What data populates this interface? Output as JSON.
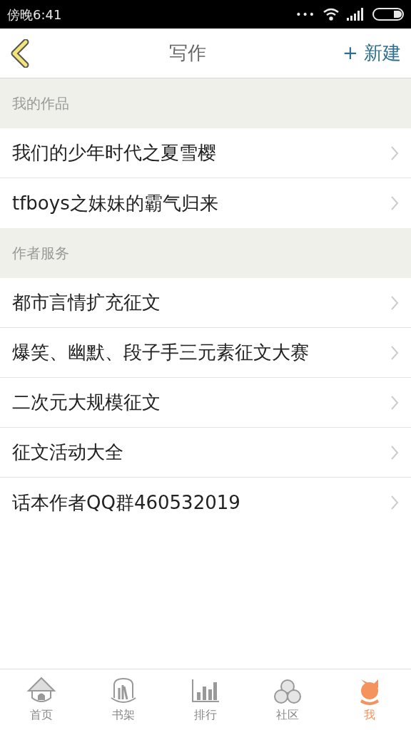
{
  "status_bar": {
    "time": "傍晚6:41",
    "dots": "•••"
  },
  "header": {
    "title": "写作",
    "action": "+ 新建"
  },
  "sections": [
    {
      "title": "我的作品",
      "items": [
        "我们的少年时代之夏雪樱",
        "tfboys之妹妹的霸气归来"
      ]
    },
    {
      "title": "作者服务",
      "items": [
        "都市言情扩充征文",
        "爆笑、幽默、段子手三元素征文大赛",
        "二次元大规模征文",
        "征文活动大全",
        "话本作者QQ群460532019"
      ]
    }
  ],
  "tabs": [
    {
      "kind": "home",
      "label": "首页",
      "selected": false
    },
    {
      "kind": "shelf",
      "label": "书架",
      "selected": false
    },
    {
      "kind": "rank",
      "label": "排行",
      "selected": false
    },
    {
      "kind": "community",
      "label": "社区",
      "selected": false
    },
    {
      "kind": "me",
      "label": "我",
      "selected": true
    }
  ]
}
